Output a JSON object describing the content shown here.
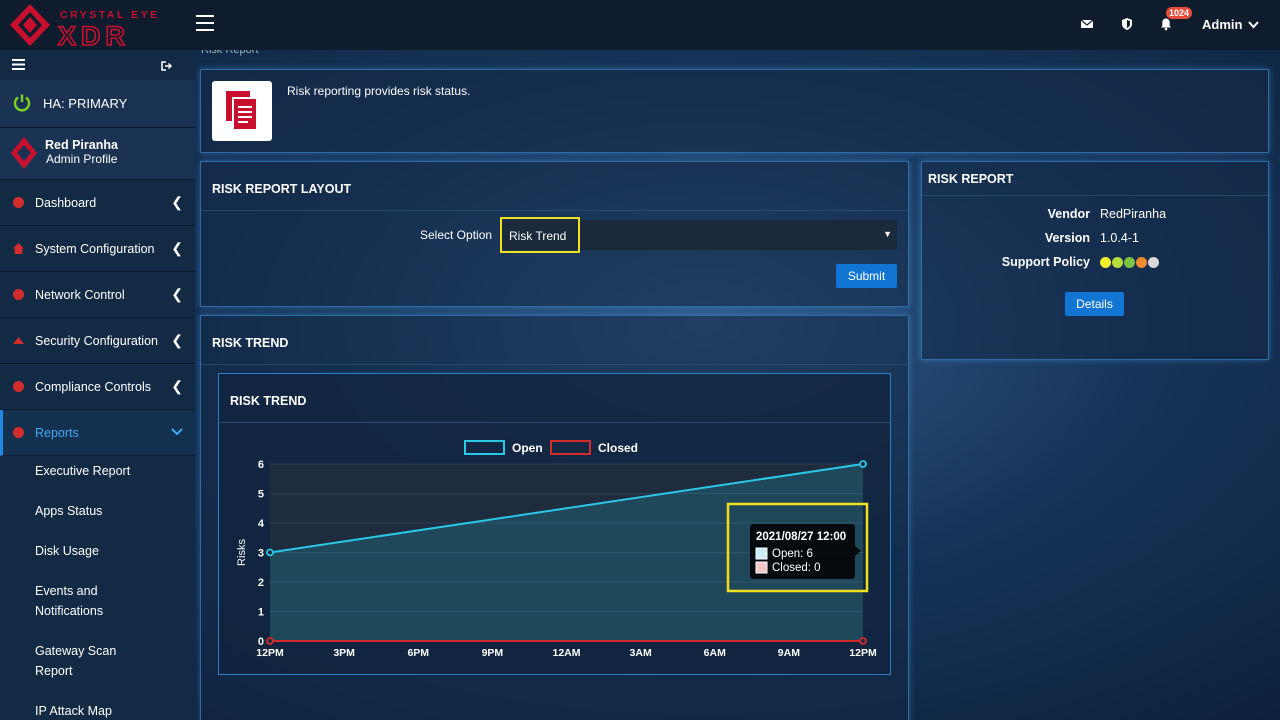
{
  "header": {
    "brand_top": "CRYSTAL EYE",
    "brand_main": "XDR",
    "notification_count": "1024",
    "user_label": "Admin"
  },
  "sidebar": {
    "ha_status": "HA: PRIMARY",
    "profile_name": "Red Piranha",
    "profile_role": "Admin Profile",
    "menu": [
      {
        "label": "Dashboard"
      },
      {
        "label": "System Configuration"
      },
      {
        "label": "Network Control"
      },
      {
        "label": "Security Configuration"
      },
      {
        "label": "Compliance Controls"
      },
      {
        "label": "Reports"
      }
    ],
    "submenu": [
      {
        "label": "Executive Report"
      },
      {
        "label": "Apps Status"
      },
      {
        "label": "Disk Usage"
      },
      {
        "label": "Events and Notifications"
      },
      {
        "label": "Gateway Scan Report"
      },
      {
        "label": "IP Attack Map"
      }
    ]
  },
  "page": {
    "breadcrumb": "Risk Report",
    "description": "Risk reporting provides risk status."
  },
  "layout_panel": {
    "title": "RISK REPORT LAYOUT",
    "select_label": "Select Option",
    "select_value": "Risk Trend",
    "submit_label": "Submit"
  },
  "risk_report_panel": {
    "title": "RISK REPORT",
    "vendor_key": "Vendor",
    "vendor_val": "RedPiranha",
    "version_key": "Version",
    "version_val": "1.0.4-1",
    "support_key": "Support Policy",
    "support_colors": [
      "#f4f12e",
      "#b7dd3c",
      "#7dc242",
      "#f08a2c",
      "#d8d8d8"
    ],
    "details_label": "Details"
  },
  "trend_panel": {
    "title": "RISK TREND",
    "inner_title": "RISK TREND"
  },
  "chart_data": {
    "type": "line",
    "ylabel": "Risks",
    "xlabel": "",
    "ylim": [
      0,
      6
    ],
    "yticks": [
      "0",
      "1",
      "2",
      "3",
      "4",
      "5",
      "6"
    ],
    "xticks": [
      "12PM",
      "3PM",
      "6PM",
      "9PM",
      "12AM",
      "3AM",
      "6AM",
      "9AM",
      "12PM"
    ],
    "x_ticks_hours": [
      0,
      3,
      6,
      9,
      12,
      15,
      18,
      21,
      24
    ],
    "series": [
      {
        "name": "Open",
        "color": "#2bc7e6",
        "points": [
          [
            0,
            3
          ],
          [
            24,
            6
          ]
        ]
      },
      {
        "name": "Closed",
        "color": "#d32a2a",
        "points": [
          [
            0,
            0
          ],
          [
            24,
            0
          ]
        ]
      }
    ],
    "legend": "top",
    "tooltip": {
      "title": "2021/08/27 12:00",
      "open_line": "Open: 6",
      "closed_line": "Closed: 0"
    }
  }
}
